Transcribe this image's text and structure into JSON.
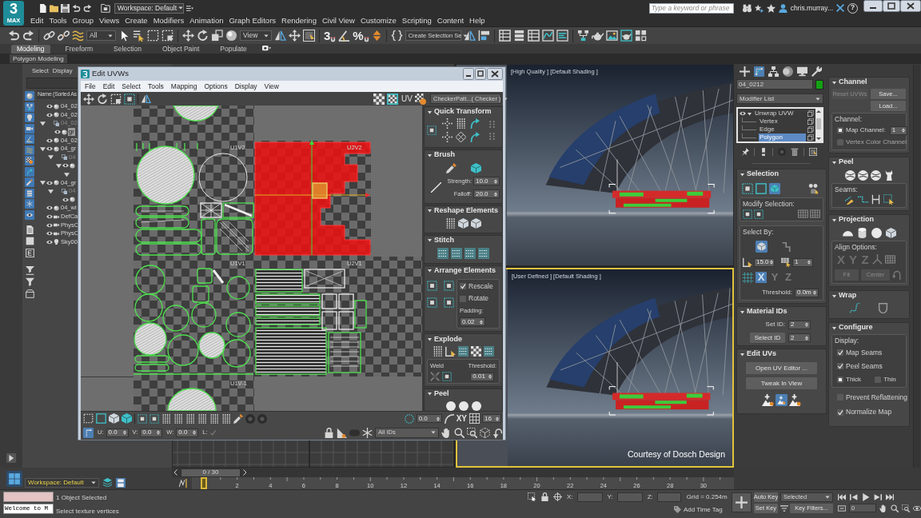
{
  "logo": {
    "mark": "3",
    "label": "MAX"
  },
  "quick_access": {
    "workspace": "Workspace: Default"
  },
  "search": {
    "placeholder": "Type a keyword or phrase"
  },
  "account": {
    "user": "chris.murray...",
    "help": "?"
  },
  "menu": [
    "Edit",
    "Tools",
    "Group",
    "Views",
    "Create",
    "Modifiers",
    "Animation",
    "Graph Editors",
    "Rendering",
    "Civil View",
    "Customize",
    "Scripting",
    "Content",
    "Help"
  ],
  "main_toolbar": {
    "selection_filter": "All",
    "reference_coordinates": "View",
    "snaps": [
      "3",
      "%"
    ],
    "named_selection": "Create Selection Se"
  },
  "ribbon": {
    "tabs": [
      {
        "label": "Modeling",
        "selected": true
      },
      {
        "label": "Freeform",
        "selected": false
      },
      {
        "label": "Selection",
        "selected": false
      },
      {
        "label": "Object Paint",
        "selected": false
      },
      {
        "label": "Populate",
        "selected": false
      }
    ],
    "panel": "Polygon Modeling"
  },
  "scene_explorer": {
    "tabs": [
      "Select",
      "Display"
    ],
    "column": "Name (Sorted As",
    "items": [
      {
        "label": "04_02",
        "kind": "geometry",
        "visible": true,
        "selected": false
      },
      {
        "label": "04_02",
        "kind": "geometry",
        "visible": true,
        "selected": false
      },
      {
        "label": "04_02",
        "kind": "group",
        "visible": false,
        "selected": false,
        "expanded": true,
        "children": [
          {
            "label": "gr",
            "kind": "geometry",
            "visible": true,
            "selected": true
          }
        ]
      },
      {
        "label": "04_02",
        "kind": "geometry",
        "visible": true,
        "selected": false
      },
      {
        "label": "04_gr",
        "kind": "geometry",
        "visible": true,
        "selected": false,
        "expanded": true,
        "children": [
          {
            "label": "04",
            "kind": "group",
            "visible": false,
            "selected": false,
            "expanded": true,
            "children": [
              {
                "kind": "geometry",
                "visible": true,
                "selected": false,
                "expanded": true,
                "children": [
                  {
                    "selected": false,
                    "expanded": true
                  }
                ]
              }
            ]
          }
        ]
      },
      {
        "label": "04_gr",
        "kind": "geometry",
        "visible": true,
        "selected": false,
        "expanded": true,
        "children": [
          {
            "label": "04",
            "kind": "group",
            "visible": false,
            "selected": false,
            "expanded": true,
            "children": [
              {
                "kind": "geometry",
                "visible": true,
                "selected": false
              }
            ]
          }
        ]
      },
      {
        "label": "04_wi",
        "kind": "geometry",
        "visible": true,
        "selected": false
      },
      {
        "label": "DefCa",
        "kind": "camera",
        "visible": true,
        "selected": false
      },
      {
        "label": "PhysC",
        "kind": "camera",
        "visible": true,
        "selected": false
      },
      {
        "label": "PhysC",
        "kind": "camera",
        "visible": true,
        "selected": false
      },
      {
        "label": "Sky00",
        "kind": "light",
        "visible": true,
        "selected": false
      }
    ]
  },
  "uv_editor": {
    "title": "Edit UVWs",
    "menu": [
      "File",
      "Edit",
      "Select",
      "Tools",
      "Mapping",
      "Options",
      "Display",
      "View"
    ],
    "toolbar_label": "UV",
    "texture": "CheckerPatt...( Checker )",
    "tiles": [
      "U1V2",
      "U2V2",
      "U1V1",
      "U2V1",
      "U1V-1"
    ],
    "rollouts": [
      {
        "kind": "quick_transform",
        "title": "Quick Transform"
      },
      {
        "kind": "brush",
        "title": "Brush",
        "fields": [
          {
            "label": "Strength:",
            "value": "10.0"
          },
          {
            "label": "Falloff:",
            "value": "20.0"
          }
        ]
      },
      {
        "kind": "reshape",
        "title": "Reshape Elements"
      },
      {
        "kind": "stitch",
        "title": "Stitch"
      },
      {
        "kind": "arrange",
        "title": "Arrange Elements",
        "options": [
          {
            "label": "Rescale",
            "checked": true
          },
          {
            "label": "Rotate",
            "checked": false
          }
        ],
        "fields": [
          {
            "label": "Padding:",
            "value": "0.02"
          }
        ]
      },
      {
        "kind": "explode",
        "title": "Explode",
        "group_label": "Weld",
        "fields": [
          {
            "label": "Threshold:",
            "value": "0.01"
          }
        ]
      },
      {
        "kind": "peel",
        "title": "Peel"
      }
    ],
    "transform_bar": {
      "value": "0.0",
      "axes": "XY",
      "grid": "16"
    },
    "coord_bar": {
      "fields": [
        {
          "label": "U:",
          "value": "0.0"
        },
        {
          "label": "V:",
          "value": "0.0"
        },
        {
          "label": "W:",
          "value": "0.0"
        }
      ],
      "lock_label": "L:",
      "id_filter": "All IDs"
    }
  },
  "viewports": [
    {
      "kind": "render",
      "label": "[High Quality ] [Default Shading ]",
      "active": false
    },
    {
      "kind": "grid",
      "active": false
    },
    {
      "kind": "render",
      "label": "[User Defined ] [Default Shading ]",
      "caption": "Courtesy of Dosch Design",
      "active": true
    }
  ],
  "command_panel": {
    "tabs": [
      {
        "selected": false
      },
      {
        "selected": true
      },
      {
        "selected": false
      },
      {
        "selected": false
      },
      {
        "selected": false
      },
      {
        "selected": false
      }
    ],
    "object": {
      "name": "04_0212",
      "color": "#14a014"
    },
    "modifier_list": "Modifier List",
    "stack": [
      {
        "label": "Unwrap UVW",
        "kind": "modifier",
        "selected": false
      },
      {
        "label": "Vertex",
        "kind": "sublevel",
        "selected": false
      },
      {
        "label": "Edge",
        "kind": "sublevel",
        "selected": false
      },
      {
        "label": "Polygon",
        "kind": "sublevel",
        "selected": true
      }
    ],
    "left": [
      {
        "kind": "selection",
        "title": "Selection",
        "modes": [
          {
            "selected": false
          },
          {
            "selected": false
          },
          {
            "selected": true
          }
        ],
        "modify_label": "Modify Selection:",
        "select_by_label": "Select By:",
        "element_select": true,
        "angle": "15.0",
        "count": "1",
        "axes": [
          {
            "label": "X",
            "selected": true
          },
          {
            "label": "Y",
            "selected": false
          },
          {
            "label": "Z",
            "selected": false
          }
        ],
        "threshold_label": "Threshold:",
        "threshold": "0.0m"
      },
      {
        "kind": "material_ids",
        "title": "Material IDs",
        "set_label": "Set ID:",
        "set_value": "2",
        "select_button": "Select ID",
        "select_value": "2"
      },
      {
        "kind": "edit_uvs",
        "title": "Edit UVs",
        "buttons": [
          "Open UV Editor ...",
          "Tweak In View"
        ],
        "tools": [
          {
            "selected": false
          },
          {
            "selected": true
          },
          {
            "selected": false
          }
        ]
      }
    ],
    "right": [
      {
        "kind": "channel",
        "title": "Channel",
        "buttons": [
          {
            "label": "Reset UVWs",
            "disabled": true
          },
          {
            "label": "Save...",
            "disabled": false
          },
          {
            "label": "Load...",
            "disabled": false
          }
        ],
        "group_label": "Channel:",
        "options": [
          {
            "label": "Map Channel:",
            "selected": true,
            "value": "1"
          },
          {
            "label": "Vertex Color Channel",
            "selected": false
          }
        ]
      },
      {
        "kind": "peel",
        "title": "Peel",
        "group_label": "Seams:"
      },
      {
        "kind": "projection",
        "title": "Projection",
        "group_label": "Align Options:",
        "axes": [
          "X",
          "Y",
          "Z"
        ],
        "buttons": [
          {
            "label": "Fit",
            "disabled": true
          },
          {
            "label": "Center",
            "disabled": true
          }
        ]
      },
      {
        "kind": "wrap",
        "title": "Wrap"
      },
      {
        "kind": "configure",
        "title": "Configure",
        "group_label": "Display:",
        "checks": [
          {
            "label": "Map Seams",
            "checked": true
          },
          {
            "label": "Peel Seams",
            "checked": true
          }
        ],
        "radios": [
          {
            "label": "Thick",
            "selected": true
          },
          {
            "label": "Thin",
            "selected": false
          }
        ],
        "options": [
          {
            "label": "Prevent Reflattening",
            "checked": false
          },
          {
            "label": "Normalize Map",
            "checked": true
          }
        ]
      }
    ]
  },
  "timeline": {
    "workspace": "Workspace: Default",
    "slider": {
      "label": "0 / 30",
      "level": 0
    },
    "ticks": [
      "2",
      "4",
      "6",
      "8",
      "10",
      "12",
      "14",
      "16",
      "18",
      "20",
      "22",
      "24",
      "26",
      "28",
      "30"
    ]
  },
  "status_bar": {
    "listener_output": "Welcome to M",
    "selection": "1 Object Selected",
    "prompt": "Select texture vertices",
    "coords": [
      "X:",
      "Y:",
      "Z:"
    ],
    "grid": "Grid = 0.254m",
    "time_tag": "Add Time Tag",
    "auto_key": "Auto Key",
    "key_mode": "Selected",
    "set_key": "Set Key",
    "key_filters": "Key Filters...",
    "current_frame": "0"
  }
}
